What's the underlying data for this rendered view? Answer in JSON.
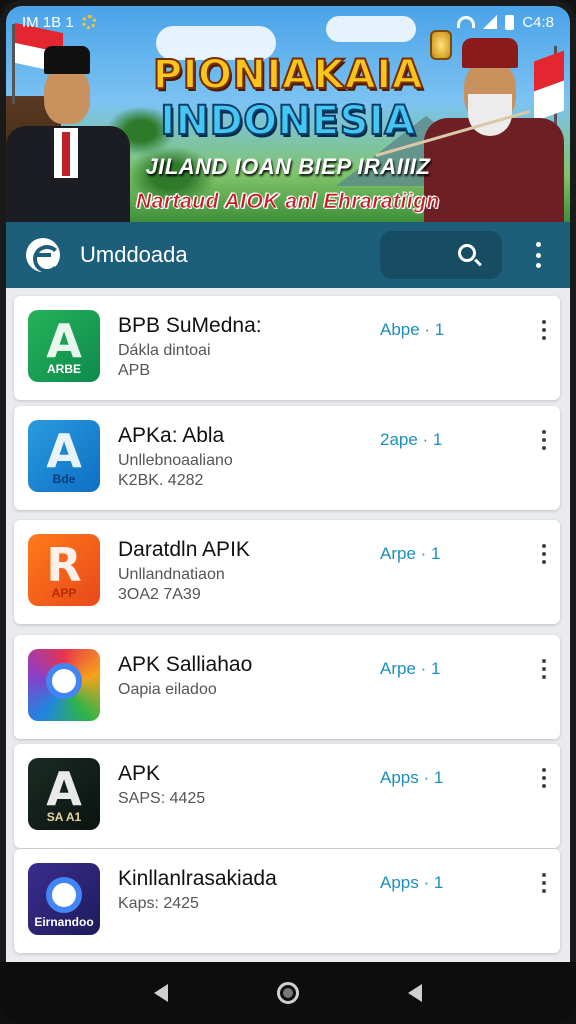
{
  "status_bar": {
    "left_text": "IM 1B 1",
    "time": "C4:8"
  },
  "banner": {
    "title_line1": "PIONIAKAIA",
    "title_line2": "INDONESIA",
    "subtitle": "JILAND IOAN BIEP IRAIIIZ",
    "tagline": "Nartaud AIOK anl Ehraratiign"
  },
  "app_bar": {
    "title": "Umddoada"
  },
  "apps": [
    {
      "name": "BPB SuMedna:",
      "line1": "Dákla dintoai",
      "line2": "APB",
      "action": "Abpe · 1",
      "icon_label": "ARBE",
      "icon_style": "green"
    },
    {
      "name": "APKa: Abla",
      "line1": "Unllebnoaaliano",
      "line2": "K2BK. 4282",
      "action": "2ape · 1",
      "icon_label": "Bde",
      "icon_style": "blue"
    },
    {
      "name": "Daratdln APIK",
      "line1": "Unllandnatiaon",
      "line2": "3OA2 7A39",
      "action": "Arpe · 1",
      "icon_label": "APP",
      "icon_style": "orange"
    },
    {
      "name": "APK Salliahao",
      "line1": "Oapia eiladoo",
      "line2": "",
      "action": "Arpe · 1",
      "icon_label": "",
      "icon_style": "colorful"
    },
    {
      "name": "APK",
      "line1": "SAPS: 4425",
      "line2": "",
      "action": "Apps · 1",
      "icon_label": "SA A1",
      "icon_style": "dark"
    },
    {
      "name": "Kinllanlrasakiada",
      "line1": "Kaps: 2425",
      "line2": "",
      "action": "Apps · 1",
      "icon_label": "Eirnandoo",
      "icon_style": "chrome"
    }
  ],
  "colors": {
    "app_bar": "#1d5f7a",
    "action_text": "#1b8fc0",
    "list_bg": "#e9ebee"
  }
}
